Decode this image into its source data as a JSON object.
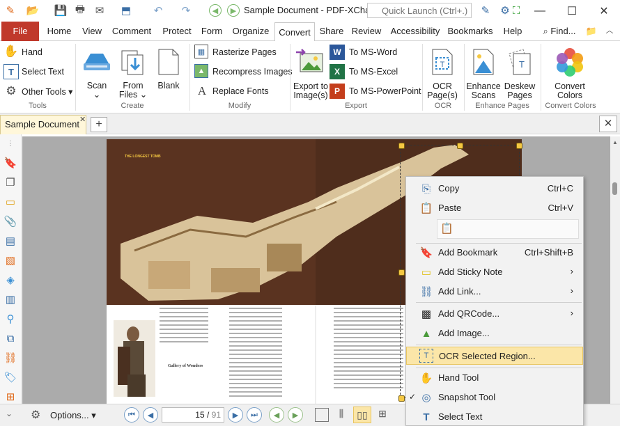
{
  "window": {
    "title": "Sample Document - PDF-XCha...",
    "quick_launch_placeholder": "Quick Launch (Ctrl+.)"
  },
  "menu": {
    "file": "File",
    "tabs": [
      "Home",
      "View",
      "Comment",
      "Protect",
      "Form",
      "Organize",
      "Convert",
      "Share",
      "Review",
      "Accessibility",
      "Bookmarks",
      "Help"
    ],
    "active_tab": "Convert",
    "find": "Find..."
  },
  "ribbon": {
    "tools": {
      "hand": "Hand",
      "select_text": "Select Text",
      "other_tools": "Other Tools",
      "group": "Tools"
    },
    "create": {
      "scan": "Scan",
      "from_files_1": "From",
      "from_files_2": "Files",
      "blank": "Blank",
      "group": "Create"
    },
    "modify": {
      "rasterize": "Rasterize Pages",
      "recompress": "Recompress Images",
      "replace_fonts": "Replace Fonts",
      "group": "Modify"
    },
    "export": {
      "export_images_1": "Export to",
      "export_images_2": "Image(s)",
      "to_word": "To MS-Word",
      "to_excel": "To MS-Excel",
      "to_ppt": "To MS-PowerPoint",
      "group": "Export"
    },
    "ocr": {
      "ocr_pages_1": "OCR",
      "ocr_pages_2": "Page(s)",
      "group": "OCR"
    },
    "enhance": {
      "enhance_1": "Enhance",
      "enhance_2": "Scans",
      "deskew_1": "Deskew",
      "deskew_2": "Pages",
      "group": "Enhance Pages"
    },
    "colors": {
      "convert_1": "Convert",
      "convert_2": "Colors",
      "group": "Convert Colors"
    }
  },
  "document_tab": {
    "name": "Sample Document"
  },
  "page_content": {
    "heading": "THE LONGEST TOMB",
    "caption_title": "Gallery of Wonders"
  },
  "bottom": {
    "options": "Options...",
    "page_number": "15",
    "page_total": "91"
  },
  "context_menu": {
    "copy": {
      "label": "Copy",
      "shortcut": "Ctrl+C"
    },
    "paste": {
      "label": "Paste",
      "shortcut": "Ctrl+V"
    },
    "add_bookmark": {
      "label": "Add Bookmark",
      "shortcut": "Ctrl+Shift+B"
    },
    "add_sticky": {
      "label": "Add Sticky Note"
    },
    "add_link": {
      "label": "Add Link..."
    },
    "add_qr": {
      "label": "Add QRCode..."
    },
    "add_image": {
      "label": "Add Image..."
    },
    "ocr_region": {
      "label": "OCR Selected Region..."
    },
    "hand_tool": {
      "label": "Hand Tool"
    },
    "snapshot_tool": {
      "label": "Snapshot Tool",
      "checked": true
    },
    "select_text": {
      "label": "Select Text"
    }
  },
  "colors": {
    "file_tab": "#c0392b",
    "accent": "#3a6ea5",
    "highlight": "#fbe6a8",
    "doc_tab": "#fff7da"
  }
}
